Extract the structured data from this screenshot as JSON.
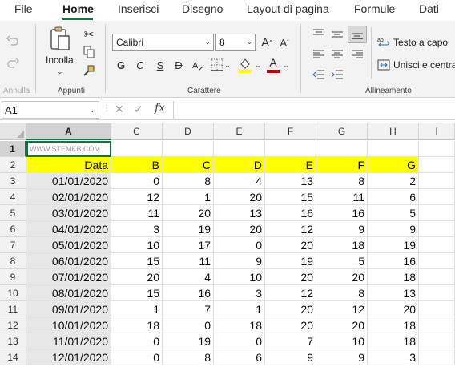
{
  "menu": {
    "tabs": [
      "File",
      "Home",
      "Inserisci",
      "Disegno",
      "Layout di pagina",
      "Formule",
      "Dati"
    ],
    "active": "Home"
  },
  "ribbon": {
    "undo_group_label": "Annulla",
    "clipboard": {
      "paste_label": "Incolla",
      "group_label": "Appunti"
    },
    "font": {
      "name": "Calibri",
      "size": "8",
      "group_label": "Carattere",
      "bold": "G",
      "italic": "C",
      "underline": "S",
      "strike": "D",
      "grow": "A",
      "shrink": "A",
      "font_color_letter": "A"
    },
    "alignment": {
      "wrap_text": "Testo a capo",
      "merge_center": "Unisci e centra",
      "group_label": "Allineamento"
    },
    "colors": {
      "highlight": "#ffff00",
      "font_color": "#c00000",
      "accent": "#1e7145"
    }
  },
  "formula_bar": {
    "name_box": "A1",
    "cancel": "✕",
    "enter": "✓",
    "fx": "fx",
    "value": ""
  },
  "sheet": {
    "columns": [
      "A",
      "C",
      "D",
      "E",
      "F",
      "G",
      "H",
      "I"
    ],
    "selected_column": "A",
    "rows": [
      "1",
      "2",
      "3",
      "4",
      "5",
      "6",
      "7",
      "8",
      "9",
      "10",
      "11",
      "12",
      "13",
      "14"
    ],
    "selected_row": "1",
    "a1_text": "WWW.STEMKB.COM",
    "header_row": [
      "Data",
      "B",
      "C",
      "D",
      "E",
      "F",
      "G"
    ],
    "data_rows": [
      [
        "01/01/2020",
        "0",
        "8",
        "4",
        "13",
        "8",
        "2"
      ],
      [
        "02/01/2020",
        "12",
        "1",
        "20",
        "15",
        "11",
        "6"
      ],
      [
        "03/01/2020",
        "11",
        "20",
        "13",
        "16",
        "16",
        "5"
      ],
      [
        "04/01/2020",
        "3",
        "19",
        "20",
        "12",
        "9",
        "9"
      ],
      [
        "05/01/2020",
        "10",
        "17",
        "0",
        "20",
        "18",
        "19"
      ],
      [
        "06/01/2020",
        "15",
        "11",
        "9",
        "19",
        "5",
        "16"
      ],
      [
        "07/01/2020",
        "20",
        "4",
        "10",
        "20",
        "20",
        "18"
      ],
      [
        "08/01/2020",
        "15",
        "16",
        "3",
        "12",
        "8",
        "13"
      ],
      [
        "09/01/2020",
        "1",
        "7",
        "1",
        "20",
        "12",
        "20"
      ],
      [
        "10/01/2020",
        "18",
        "0",
        "18",
        "20",
        "20",
        "18"
      ],
      [
        "11/01/2020",
        "0",
        "19",
        "0",
        "7",
        "10",
        "18"
      ],
      [
        "12/01/2020",
        "0",
        "8",
        "6",
        "9",
        "9",
        "3"
      ]
    ]
  }
}
